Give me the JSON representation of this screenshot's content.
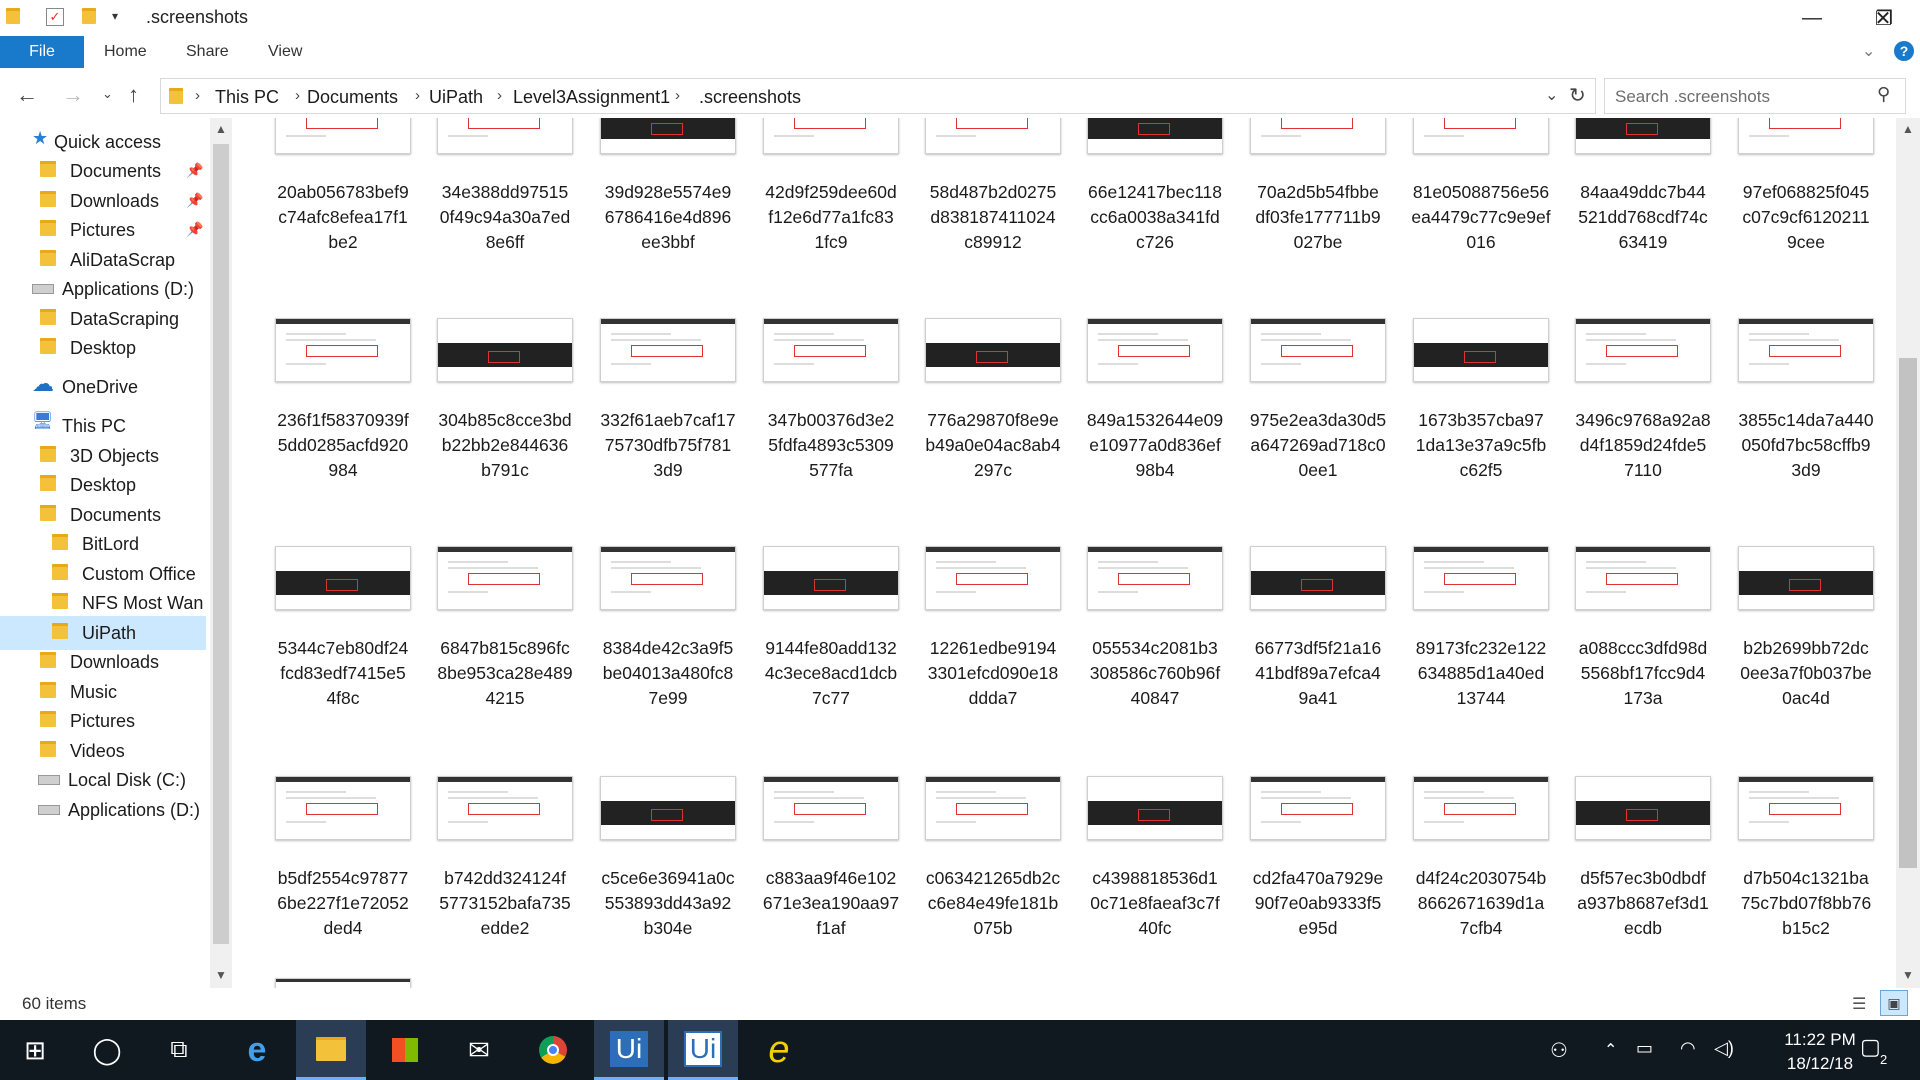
{
  "window": {
    "title": ".screenshots",
    "minimize_glyph": "—",
    "restore_glyph": "❐",
    "close_glyph": "✕"
  },
  "ribbon": {
    "tabs": [
      "File",
      "Home",
      "Share",
      "View"
    ]
  },
  "address": {
    "crumbs": [
      "This PC",
      "Documents",
      "UiPath",
      "Level3Assignment1",
      ".screenshots"
    ],
    "search_placeholder": "Search .screenshots"
  },
  "nav": {
    "items": [
      {
        "label": "Quick access",
        "icon": "star-icon",
        "pinned": false
      },
      {
        "label": "Documents",
        "icon": "folder-icon",
        "pinned": true
      },
      {
        "label": "Downloads",
        "icon": "folder-icon",
        "pinned": true
      },
      {
        "label": "Pictures",
        "icon": "folder-icon",
        "pinned": true
      },
      {
        "label": "AliDataScrap",
        "icon": "folder-icon",
        "pinned": false
      },
      {
        "label": "Applications (D:)",
        "icon": "drive-icon",
        "pinned": false
      },
      {
        "label": "DataScraping",
        "icon": "folder-icon",
        "pinned": false
      },
      {
        "label": "Desktop",
        "icon": "folder-icon",
        "pinned": false
      },
      {
        "label": "OneDrive",
        "icon": "cloud-icon",
        "pinned": false
      },
      {
        "label": "This PC",
        "icon": "computer-icon",
        "pinned": false
      },
      {
        "label": "3D Objects",
        "icon": "folder-icon",
        "pinned": false
      },
      {
        "label": "Desktop",
        "icon": "folder-icon",
        "pinned": false
      },
      {
        "label": "Documents",
        "icon": "folder-icon",
        "pinned": false
      },
      {
        "label": "BitLord",
        "icon": "folder-icon",
        "pinned": false
      },
      {
        "label": "Custom Office",
        "icon": "folder-icon",
        "pinned": false
      },
      {
        "label": "NFS Most Wan",
        "icon": "folder-icon",
        "pinned": false
      },
      {
        "label": "UiPath",
        "icon": "folder-icon",
        "pinned": false
      },
      {
        "label": "Downloads",
        "icon": "folder-icon",
        "pinned": false
      },
      {
        "label": "Music",
        "icon": "folder-icon",
        "pinned": false
      },
      {
        "label": "Pictures",
        "icon": "folder-icon",
        "pinned": false
      },
      {
        "label": "Videos",
        "icon": "folder-icon",
        "pinned": false
      },
      {
        "label": "Local Disk (C:)",
        "icon": "drive-icon",
        "pinned": false
      },
      {
        "label": "Applications (D:)",
        "icon": "drive-icon",
        "pinned": false
      }
    ],
    "selected_index": 16
  },
  "files": [
    [
      "20ab056783bef9",
      "c74afc8efea17f1",
      "be2"
    ],
    [
      "34e388dd97515",
      "0f49c94a30a7ed",
      "8e6ff"
    ],
    [
      "39d928e5574e9",
      "6786416e4d896",
      "ee3bbf"
    ],
    [
      "42d9f259dee60d",
      "f12e6d77a1fc83",
      "1fc9"
    ],
    [
      "58d487b2d0275",
      "d838187411024",
      "c89912"
    ],
    [
      "66e12417bec118",
      "cc6a0038a341fd",
      "c726"
    ],
    [
      "70a2d5b54fbbe",
      "df03fe177711b9",
      "027be"
    ],
    [
      "81e05088756e56",
      "ea4479c77c9e9ef",
      "016"
    ],
    [
      "84aa49ddc7b44",
      "521dd768cdf74c",
      "63419"
    ],
    [
      "97ef068825f045",
      "c07c9cf6120211",
      "9cee"
    ],
    [
      "236f1f58370939f",
      "5dd0285acfd920",
      "984"
    ],
    [
      "304b85c8cce3bd",
      "b22bb2e844636",
      "b791c"
    ],
    [
      "332f61aeb7caf17",
      "75730dfb75f781",
      "3d9"
    ],
    [
      "347b00376d3e2",
      "5fdfa4893c5309",
      "577fa"
    ],
    [
      "776a29870f8e9e",
      "b49a0e04ac8ab4",
      "297c"
    ],
    [
      "849a1532644e09",
      "e10977a0d836ef",
      "98b4"
    ],
    [
      "975e2ea3da30d5",
      "a647269ad718c0",
      "0ee1"
    ],
    [
      "1673b357cba97",
      "1da13e37a9c5fb",
      "c62f5"
    ],
    [
      "3496c9768a92a8",
      "d4f1859d24fde5",
      "7110"
    ],
    [
      "3855c14da7a440",
      "050fd7bc58cffb9",
      "3d9"
    ],
    [
      "5344c7eb80df24",
      "fcd83edf7415e5",
      "4f8c"
    ],
    [
      "6847b815c896fc",
      "8be953ca28e489",
      "4215"
    ],
    [
      "8384de42c3a9f5",
      "be04013a480fc8",
      "7e99"
    ],
    [
      "9144fe80add132",
      "4c3ece8acd1dcb",
      "7c77"
    ],
    [
      "12261edbe9194",
      "3301efcd090e18",
      "ddda7"
    ],
    [
      "055534c2081b3",
      "308586c760b96f",
      "40847"
    ],
    [
      "66773df5f21a16",
      "41bdf89a7efca4",
      "9a41"
    ],
    [
      "89173fc232e122",
      "634885d1a40ed",
      "13744"
    ],
    [
      "a088ccc3dfd98d",
      "5568bf17fcc9d4",
      "173a"
    ],
    [
      "b2b2699bb72dc",
      "0ee3a7f0b037be",
      "0ac4d"
    ],
    [
      "b5df2554c97877",
      "6be227f1e72052",
      "ded4"
    ],
    [
      "b742dd324124f",
      "5773152bafa735",
      "edde2"
    ],
    [
      "c5ce6e36941a0c",
      "553893dd43a92",
      "b304e"
    ],
    [
      "c883aa9f46e102",
      "671e3ea190aa97",
      "f1af"
    ],
    [
      "c063421265db2c",
      "c6e84e49fe181b",
      "075b"
    ],
    [
      "c4398818536d1",
      "0c71e8faeaf3c7f",
      "40fc"
    ],
    [
      "cd2fa470a7929e",
      "90f7e0ab9333f5",
      "e95d"
    ],
    [
      "d4f24c2030754b",
      "8662671639d1a",
      "7cfb4"
    ],
    [
      "d5f57ec3b0dbdf",
      "a937b8687ef3d1",
      "ecdb"
    ],
    [
      "d7b504c1321ba",
      "75c7bd07f8bb76",
      "b15c2"
    ]
  ],
  "status": {
    "item_count": "60 items"
  },
  "taskbar": {
    "apps": [
      "start-icon",
      "cortana-icon",
      "task-view-icon",
      "edge-icon",
      "file-explorer-icon",
      "store-icon",
      "mail-icon",
      "chrome-icon",
      "uipath-studio-icon",
      "uipath-robot-icon",
      "internet-explorer-icon"
    ],
    "time": "11:22 PM",
    "date": "18/12/18",
    "notification_count": "2"
  }
}
